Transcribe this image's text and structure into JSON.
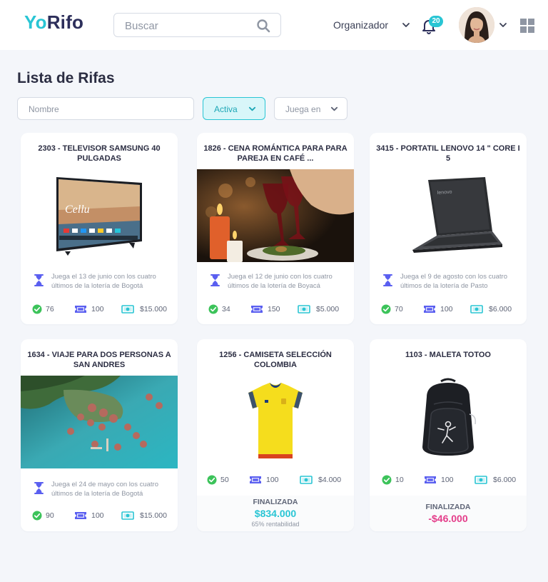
{
  "header": {
    "logo_yo": "Yo",
    "logo_rifo": "Rifo",
    "search_placeholder": "Buscar",
    "user_role": "Organizador",
    "notifications_count": "20"
  },
  "page": {
    "title": "Lista de Rifas"
  },
  "filters": {
    "name_placeholder": "Nombre",
    "status_value": "Activa",
    "plays_in_value": "Juega en"
  },
  "colors": {
    "accent": "#29c5d4",
    "brand_dark": "#2d2f5b",
    "success": "#3cc35a",
    "tickets": "#5a5ff0",
    "positive_amount": "#29c5d4",
    "negative_amount": "#e43d8a"
  },
  "icons": {
    "search": "search-icon",
    "chevron": "chevron-down-icon",
    "bell": "bell-icon",
    "grid": "grid-icon",
    "hourglass": "hourglass-icon",
    "check": "check-circle-icon",
    "ticket": "ticket-icon",
    "money": "money-icon"
  },
  "raffles": [
    {
      "title": "2303 - TELEVISOR SAMSUNG 40 PULGADAS",
      "image": "tv",
      "info": "Juega el 13 de junio con los cuatro últimos de la lotería de Bogotá",
      "sold": "76",
      "tickets": "100",
      "price": "$15.000"
    },
    {
      "title": "1826 - CENA ROMÁNTICA PARA PARA PAREJA EN CAFÉ ...",
      "image": "dinner",
      "info": "Juega el 12 de junio con los cuatro últimos de la lotería de Boyacá",
      "sold": "34",
      "tickets": "150",
      "price": "$5.000"
    },
    {
      "title": "3415 - PORTATIL LENOVO 14 \" CORE I 5",
      "image": "laptop",
      "info": "Juega el 9 de agosto con los cuatro últimos de la lotería de Pasto",
      "sold": "70",
      "tickets": "100",
      "price": "$6.000"
    },
    {
      "title": "1634 - VIAJE PARA DOS PERSONAS A SAN ANDRES",
      "image": "island",
      "info": "Juega el 24 de mayo con los cuatro últimos de la lotería de Bogotá",
      "sold": "90",
      "tickets": "100",
      "price": "$15.000"
    },
    {
      "title": "1256 - CAMISETA SELECCIÓN COLOMBIA",
      "image": "shirt",
      "sold": "50",
      "tickets": "100",
      "price": "$4.000",
      "status": "FINALIZADA",
      "result_amount": "$834.000",
      "result_note": "65% rentabilidad"
    },
    {
      "title": "1103 - MALETA TOTOO",
      "image": "backpack",
      "sold": "10",
      "tickets": "100",
      "price": "$6.000",
      "status": "FINALIZADA",
      "result_amount": "-$46.000"
    }
  ]
}
